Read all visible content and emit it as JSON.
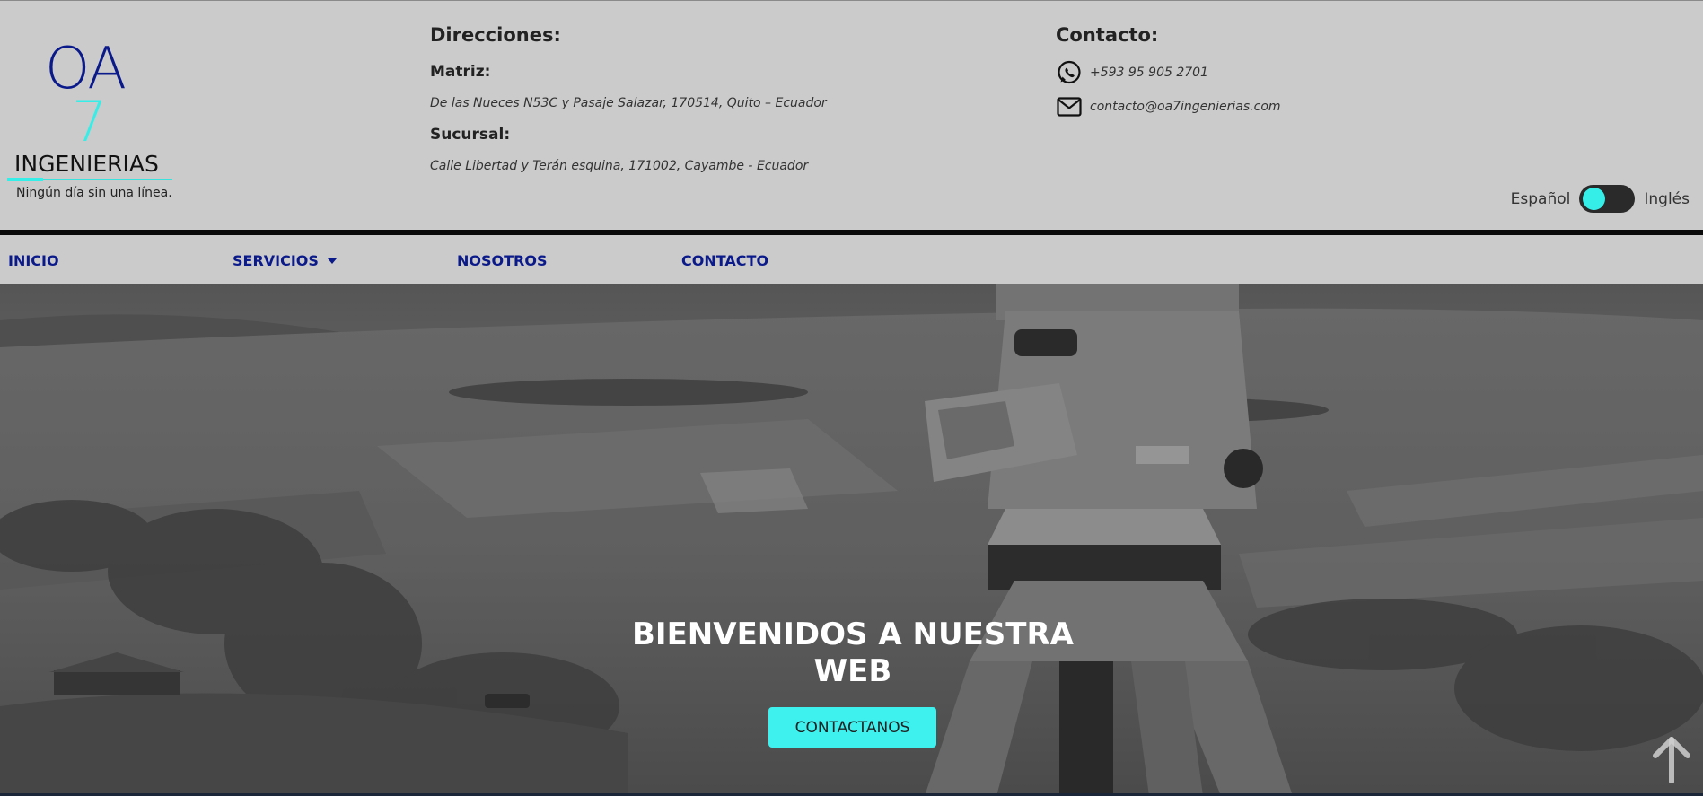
{
  "brand": {
    "logo_top": "OA",
    "logo_number": "7",
    "logo_name": "INGENIERIAS",
    "tagline": "Ningún día sin una línea.",
    "accent_color": "#35eee8",
    "primary_color": "#0b1a8a"
  },
  "addresses": {
    "title": "Direcciones:",
    "matriz_label": "Matriz:",
    "matriz_address": "De las Nueces N53C y Pasaje Salazar, 170514, Quito – Ecuador",
    "sucursal_label": "Sucursal:",
    "sucursal_address": "Calle Libertad y Terán esquina, 171002, Cayambe - Ecuador"
  },
  "contact": {
    "title": "Contacto:",
    "phone": "+593 95 905 2701",
    "phone_icon": "whatsapp-icon",
    "email": "contacto@oa7ingenierias.com",
    "email_icon": "envelope-icon"
  },
  "language": {
    "left_label": "Español",
    "right_label": "Inglés"
  },
  "nav": {
    "items": [
      {
        "label": "INICIO"
      },
      {
        "label": "SERVICIOS",
        "has_dropdown": true
      },
      {
        "label": "NOSOTROS"
      },
      {
        "label": "CONTACTO"
      }
    ]
  },
  "hero": {
    "title_line1": "BIENVENIDOS A NUESTRA",
    "title_line2": "WEB",
    "cta_label": "CONTACTANOS",
    "scroll_top_icon": "arrow-up-icon"
  }
}
